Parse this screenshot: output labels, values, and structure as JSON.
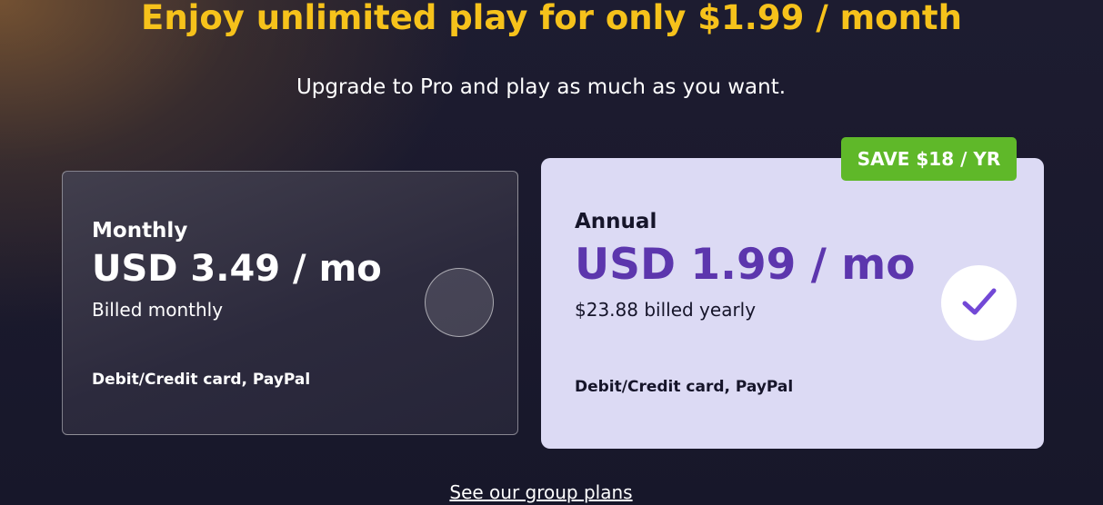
{
  "header": {
    "title": "Enjoy unlimited play for only $1.99 / month",
    "subtitle": "Upgrade to Pro and play as much as you want."
  },
  "plans": [
    {
      "name": "Monthly",
      "price": "USD 3.49 / mo",
      "billing": "Billed monthly",
      "payment_methods": "Debit/Credit card, PayPal",
      "selected": false
    },
    {
      "name": "Annual",
      "price": "USD 1.99 / mo",
      "billing": "$23.88 billed yearly",
      "payment_methods": "Debit/Credit card, PayPal",
      "selected": true,
      "badge": "SAVE $18 / YR"
    }
  ],
  "footer": {
    "group_plans_link": "See our group plans"
  },
  "colors": {
    "headline": "#f6c21b",
    "badge": "#5fb829",
    "annual_price": "#5c36ad",
    "annual_card": "#dcdaf4",
    "checkmark": "#7248d6"
  },
  "icons": {
    "selected_indicator": "checkmark-icon",
    "unselected_indicator": "radio-empty"
  }
}
